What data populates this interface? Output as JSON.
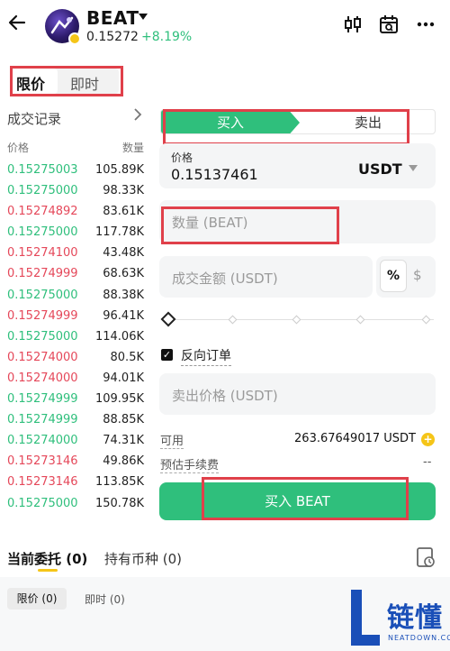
{
  "header": {
    "symbol": "BEAT",
    "price": "0.15272",
    "change": "+8.19%"
  },
  "order_type_tabs": {
    "limit": "限价",
    "market": "即时"
  },
  "trade_records": {
    "title": "成交记录",
    "price_col": "价格",
    "qty_col": "数量",
    "rows": [
      {
        "price": "0.15275003",
        "qty": "105.89K",
        "side": "buy"
      },
      {
        "price": "0.15275000",
        "qty": "98.33K",
        "side": "buy"
      },
      {
        "price": "0.15274892",
        "qty": "83.61K",
        "side": "sell"
      },
      {
        "price": "0.15275000",
        "qty": "117.78K",
        "side": "buy"
      },
      {
        "price": "0.15274100",
        "qty": "43.48K",
        "side": "sell"
      },
      {
        "price": "0.15274999",
        "qty": "68.63K",
        "side": "sell"
      },
      {
        "price": "0.15275000",
        "qty": "88.38K",
        "side": "buy"
      },
      {
        "price": "0.15274999",
        "qty": "96.41K",
        "side": "sell"
      },
      {
        "price": "0.15275000",
        "qty": "114.06K",
        "side": "buy"
      },
      {
        "price": "0.15274000",
        "qty": "80.5K",
        "side": "sell"
      },
      {
        "price": "0.15274000",
        "qty": "94.01K",
        "side": "sell"
      },
      {
        "price": "0.15274999",
        "qty": "109.95K",
        "side": "buy"
      },
      {
        "price": "0.15274999",
        "qty": "88.85K",
        "side": "buy"
      },
      {
        "price": "0.15274000",
        "qty": "74.31K",
        "side": "buy"
      },
      {
        "price": "0.15273146",
        "qty": "49.86K",
        "side": "sell"
      },
      {
        "price": "0.15273146",
        "qty": "113.85K",
        "side": "sell"
      },
      {
        "price": "0.15275000",
        "qty": "150.78K",
        "side": "buy"
      }
    ]
  },
  "order_form": {
    "buy_tab": "买入",
    "sell_tab": "卖出",
    "price_label": "价格",
    "price_value": "0.15137461",
    "price_unit": "USDT",
    "qty_placeholder": "数量 (BEAT)",
    "amount_placeholder": "成交金额 (USDT)",
    "pct_toggle": "%",
    "dollar_toggle": "$",
    "reverse_order_label": "反向订单",
    "reverse_order_checked": true,
    "sell_price_placeholder": "卖出价格 (USDT)",
    "available_label": "可用",
    "available_value": "263.67649017 USDT",
    "fee_label": "预估手续费",
    "fee_value": "--",
    "submit_label": "买入 BEAT"
  },
  "bottom_tabs": {
    "orders": "当前委托 (0)",
    "holdings": "持有币种 (0)"
  },
  "sub_filters": {
    "limit": "限价 (0)",
    "market": "即时 (0)"
  },
  "watermark": {
    "text": "链懂",
    "sub": "NEATDOWN.COM"
  },
  "colors": {
    "green": "#2fbf7c",
    "red": "#e5485a",
    "accent_yellow": "#f5c518",
    "highlight_box": "#e0404a"
  }
}
